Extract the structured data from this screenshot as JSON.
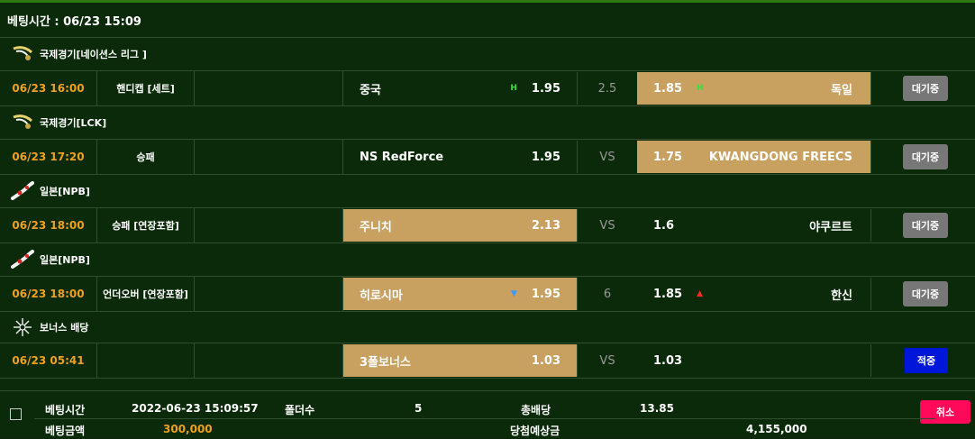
{
  "header": {
    "bet_time_label": "베팅시간 : 06/23 15:09"
  },
  "leagues": [
    {
      "name": "국제경기[네이션스 리그 ]",
      "icon": "globe-swoosh-icon"
    },
    {
      "name": "국제경기[LCK]",
      "icon": "globe-swoosh-icon"
    },
    {
      "name": "일본[NPB]",
      "icon": "japan-map-icon"
    },
    {
      "name": "일본[NPB]",
      "icon": "japan-map-icon"
    },
    {
      "name": "보너스 배당",
      "icon": "bonus-sparkle-icon"
    }
  ],
  "games": [
    {
      "time": "06/23 16:00",
      "type": "핸디캡 [세트]",
      "home": "중국",
      "home_odds": "1.95",
      "home_mark": "H",
      "mid": "2.5",
      "away_odds": "1.85",
      "away_mark": "H",
      "away": "독일",
      "status": "대기중",
      "selected": "away"
    },
    {
      "time": "06/23 17:20",
      "type": "승패",
      "home": "NS RedForce",
      "home_odds": "1.95",
      "home_mark": "",
      "mid": "VS",
      "away_odds": "1.75",
      "away_mark": "",
      "away": "KWANGDONG FREECS",
      "status": "대기중",
      "selected": "away"
    },
    {
      "time": "06/23 18:00",
      "type": "승패 [연장포함]",
      "home": "주니치",
      "home_odds": "2.13",
      "home_mark": "",
      "mid": "VS",
      "away_odds": "1.6",
      "away_mark": "",
      "away": "야쿠르트",
      "status": "대기중",
      "selected": "home"
    },
    {
      "time": "06/23 18:00",
      "type": "언더오버 [연장포함]",
      "home": "히로시마",
      "home_odds": "1.95",
      "home_mark": "▼",
      "mid": "6",
      "away_odds": "1.85",
      "away_mark": "▲",
      "away": "한신",
      "status": "대기중",
      "selected": "home"
    },
    {
      "time": "06/23 05:41",
      "type": "",
      "home": "3폴보너스",
      "home_odds": "1.03",
      "home_mark": "",
      "mid": "VS",
      "away_odds": "1.03",
      "away_mark": "",
      "away": "",
      "status": "적중",
      "selected": "home"
    }
  ],
  "footer": {
    "bet_time_label": "베팅시간",
    "bet_time_value": "2022-06-23 15:09:57",
    "folder_label": "폴더수",
    "folder_value": "5",
    "total_odds_label": "총배당",
    "total_odds_value": "13.85",
    "bet_amount_label": "베팅금액",
    "bet_amount_value": "300,000",
    "expected_label": "당첨예상금",
    "expected_value": "4,155,000",
    "cancel_label": "취소"
  },
  "colors": {
    "selected_bg": "#c8a060",
    "time_color": "#f0a020",
    "cancel_bg": "#ff0a5a",
    "win_bg": "#0016d8"
  }
}
